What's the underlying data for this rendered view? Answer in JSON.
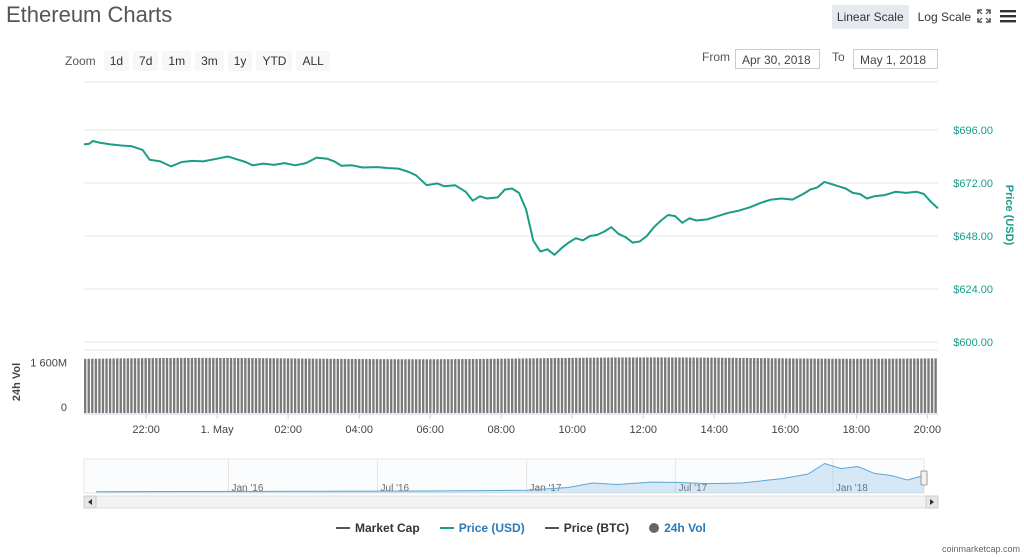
{
  "header": {
    "title": "Ethereum Charts",
    "linear_scale": "Linear Scale",
    "log_scale": "Log Scale"
  },
  "zoom": {
    "label": "Zoom",
    "buttons": [
      "1d",
      "7d",
      "1m",
      "3m",
      "1y",
      "YTD",
      "ALL"
    ],
    "active": "1d"
  },
  "range": {
    "from_label": "From",
    "from_value": "Apr 30, 2018",
    "to_label": "To",
    "to_value": "May 1, 2018"
  },
  "legend": [
    {
      "label": "Market Cap",
      "color": "#555555",
      "kind": "line"
    },
    {
      "label": "Price (USD)",
      "color": "#1a9c87",
      "kind": "line"
    },
    {
      "label": "Price (BTC)",
      "color": "#555555",
      "kind": "line"
    },
    {
      "label": "24h Vol",
      "color": "#666666",
      "kind": "dot"
    }
  ],
  "credits": "coinmarketcap.com",
  "chart_data": {
    "type": "line",
    "title": "Ethereum Charts",
    "price_axis_label": "Price (USD)",
    "volume_axis_label": "24h Vol",
    "price_ticks": [
      "$696.00",
      "$672.00",
      "$648.00",
      "$624.00",
      "$600.00"
    ],
    "price_tick_values": [
      696,
      672,
      648,
      624,
      600
    ],
    "volume_ticks": [
      "1 600M",
      "0"
    ],
    "x_ticks": [
      "22:00",
      "1. May",
      "02:00",
      "04:00",
      "06:00",
      "08:00",
      "10:00",
      "12:00",
      "14:00",
      "16:00",
      "18:00",
      "20:00"
    ],
    "x_tick_hours": [
      -2,
      0,
      2,
      4,
      6,
      8,
      10,
      12,
      14,
      16,
      18,
      20
    ],
    "x_range_hours": [
      -3.75,
      20.3
    ],
    "price_ylim": [
      600,
      720
    ],
    "volume_max": 2000,
    "volume_level": 1720,
    "volume_bar_count": 240,
    "series": [
      {
        "name": "Price (USD)",
        "color": "#1a9c87",
        "points": [
          [
            -3.75,
            689.5
          ],
          [
            -3.6,
            689.8
          ],
          [
            -3.5,
            691.0
          ],
          [
            -3.3,
            690.2
          ],
          [
            -3.0,
            689.5
          ],
          [
            -2.7,
            689.0
          ],
          [
            -2.4,
            688.6
          ],
          [
            -2.1,
            687.0
          ],
          [
            -1.9,
            682.5
          ],
          [
            -1.6,
            681.8
          ],
          [
            -1.3,
            679.5
          ],
          [
            -1.0,
            681.5
          ],
          [
            -0.7,
            682.0
          ],
          [
            -0.4,
            681.8
          ],
          [
            0.0,
            683.0
          ],
          [
            0.3,
            684.0
          ],
          [
            0.5,
            683.0
          ],
          [
            0.8,
            681.5
          ],
          [
            1.0,
            680.0
          ],
          [
            1.3,
            680.8
          ],
          [
            1.6,
            680.2
          ],
          [
            1.9,
            681.0
          ],
          [
            2.2,
            680.0
          ],
          [
            2.5,
            681.0
          ],
          [
            2.8,
            683.5
          ],
          [
            3.1,
            683.0
          ],
          [
            3.3,
            681.8
          ],
          [
            3.5,
            679.8
          ],
          [
            3.8,
            680.0
          ],
          [
            4.1,
            679.0
          ],
          [
            4.5,
            679.2
          ],
          [
            4.8,
            678.8
          ],
          [
            5.1,
            678.5
          ],
          [
            5.4,
            677.0
          ],
          [
            5.6,
            675.5
          ],
          [
            5.9,
            671.0
          ],
          [
            6.2,
            671.8
          ],
          [
            6.4,
            670.5
          ],
          [
            6.7,
            671.0
          ],
          [
            7.0,
            668.0
          ],
          [
            7.2,
            664.0
          ],
          [
            7.4,
            666.0
          ],
          [
            7.6,
            665.0
          ],
          [
            7.9,
            665.5
          ],
          [
            8.1,
            669.0
          ],
          [
            8.3,
            669.5
          ],
          [
            8.5,
            667.5
          ],
          [
            8.7,
            660.0
          ],
          [
            8.9,
            646.0
          ],
          [
            9.1,
            641.0
          ],
          [
            9.3,
            642.0
          ],
          [
            9.5,
            639.5
          ],
          [
            9.7,
            642.5
          ],
          [
            9.9,
            645.0
          ],
          [
            10.1,
            647.0
          ],
          [
            10.3,
            646.0
          ],
          [
            10.5,
            648.0
          ],
          [
            10.7,
            648.5
          ],
          [
            10.9,
            650.0
          ],
          [
            11.1,
            652.0
          ],
          [
            11.3,
            649.0
          ],
          [
            11.5,
            647.5
          ],
          [
            11.7,
            645.0
          ],
          [
            11.9,
            645.5
          ],
          [
            12.1,
            648.0
          ],
          [
            12.3,
            652.0
          ],
          [
            12.5,
            655.0
          ],
          [
            12.7,
            657.5
          ],
          [
            12.9,
            657.0
          ],
          [
            13.1,
            654.0
          ],
          [
            13.3,
            656.0
          ],
          [
            13.5,
            655.0
          ],
          [
            13.8,
            655.5
          ],
          [
            14.1,
            657.0
          ],
          [
            14.4,
            658.5
          ],
          [
            14.7,
            659.5
          ],
          [
            15.0,
            661.0
          ],
          [
            15.3,
            663.0
          ],
          [
            15.6,
            664.5
          ],
          [
            15.9,
            665.0
          ],
          [
            16.2,
            664.5
          ],
          [
            16.5,
            667.0
          ],
          [
            16.7,
            669.0
          ],
          [
            16.9,
            670.0
          ],
          [
            17.1,
            672.5
          ],
          [
            17.3,
            671.5
          ],
          [
            17.5,
            670.5
          ],
          [
            17.7,
            669.5
          ],
          [
            17.9,
            667.5
          ],
          [
            18.1,
            667.0
          ],
          [
            18.3,
            665.0
          ],
          [
            18.5,
            666.0
          ],
          [
            18.8,
            666.5
          ],
          [
            19.1,
            668.0
          ],
          [
            19.4,
            667.5
          ],
          [
            19.7,
            668.0
          ],
          [
            19.9,
            667.0
          ],
          [
            20.1,
            663.5
          ],
          [
            20.3,
            660.5
          ]
        ]
      }
    ],
    "navigator": {
      "x_ticks": [
        "Jan '16",
        "Jul '16",
        "Jan '17",
        "Jul '17",
        "Jan '18"
      ],
      "series": [
        [
          0,
          0.01
        ],
        [
          0.18,
          0.02
        ],
        [
          0.27,
          0.025
        ],
        [
          0.36,
          0.03
        ],
        [
          0.45,
          0.04
        ],
        [
          0.52,
          0.06
        ],
        [
          0.57,
          0.15
        ],
        [
          0.6,
          0.3
        ],
        [
          0.63,
          0.25
        ],
        [
          0.67,
          0.33
        ],
        [
          0.7,
          0.32
        ],
        [
          0.74,
          0.28
        ],
        [
          0.78,
          0.3
        ],
        [
          0.8,
          0.36
        ],
        [
          0.83,
          0.45
        ],
        [
          0.86,
          0.6
        ],
        [
          0.88,
          0.95
        ],
        [
          0.9,
          0.78
        ],
        [
          0.92,
          0.85
        ],
        [
          0.94,
          0.62
        ],
        [
          0.96,
          0.55
        ],
        [
          0.98,
          0.4
        ],
        [
          1.0,
          0.55
        ]
      ]
    }
  }
}
